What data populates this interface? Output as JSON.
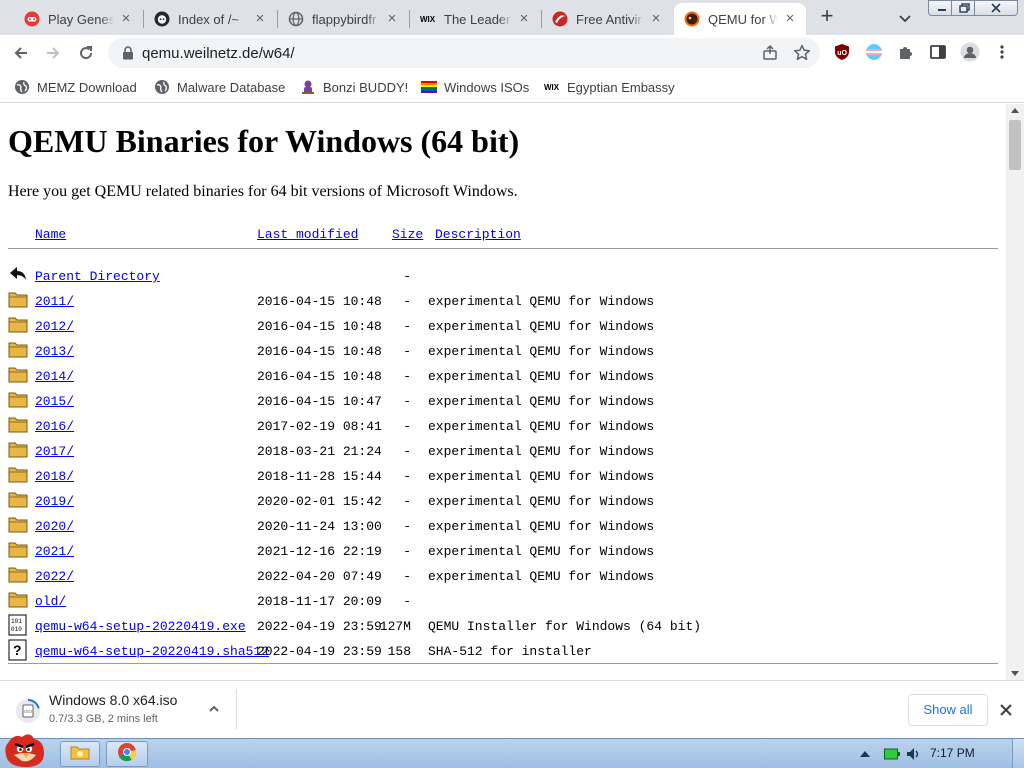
{
  "browser": {
    "tabs": [
      {
        "title": "Play Genesis",
        "favicon": "red-game-icon"
      },
      {
        "title": "Index of /~",
        "favicon": "github-cat-icon"
      },
      {
        "title": "flappybirdfr",
        "favicon": "globe-icon"
      },
      {
        "title": "The Leader",
        "favicon": "wix-icon"
      },
      {
        "title": "Free Antivir",
        "favicon": "red-shield-icon"
      },
      {
        "title": "QEMU for W",
        "favicon": "qemu-icon",
        "active": true
      }
    ],
    "new_tab": "+",
    "url": "qemu.weilnetz.de/w64/",
    "bookmarks": [
      {
        "label": "MEMZ Download",
        "icon": "globe-icon"
      },
      {
        "label": "Malware Database",
        "icon": "globe-icon"
      },
      {
        "label": "Bonzi BUDDY!",
        "icon": "bonzi-icon"
      },
      {
        "label": "Windows ISOs",
        "icon": "rainbow-flag-icon"
      },
      {
        "label": "Egyptian Embassy",
        "icon": "wix-icon"
      }
    ]
  },
  "page": {
    "title": "QEMU Binaries for Windows (64 bit)",
    "intro": "Here you get QEMU related binaries for 64 bit versions of Microsoft Windows.",
    "headers": {
      "name": "Name",
      "modified": "Last modified",
      "size": "Size",
      "description": "Description"
    },
    "rows": [
      {
        "icon": "back",
        "name": "Parent Directory",
        "date": "",
        "size": "-",
        "desc": ""
      },
      {
        "icon": "folder",
        "name": "2011/",
        "date": "2016-04-15 10:48",
        "size": "-",
        "desc": "experimental QEMU for Windows"
      },
      {
        "icon": "folder",
        "name": "2012/",
        "date": "2016-04-15 10:48",
        "size": "-",
        "desc": "experimental QEMU for Windows"
      },
      {
        "icon": "folder",
        "name": "2013/",
        "date": "2016-04-15 10:48",
        "size": "-",
        "desc": "experimental QEMU for Windows"
      },
      {
        "icon": "folder",
        "name": "2014/",
        "date": "2016-04-15 10:48",
        "size": "-",
        "desc": "experimental QEMU for Windows"
      },
      {
        "icon": "folder",
        "name": "2015/",
        "date": "2016-04-15 10:47",
        "size": "-",
        "desc": "experimental QEMU for Windows"
      },
      {
        "icon": "folder",
        "name": "2016/",
        "date": "2017-02-19 08:41",
        "size": "-",
        "desc": "experimental QEMU for Windows"
      },
      {
        "icon": "folder",
        "name": "2017/",
        "date": "2018-03-21 21:24",
        "size": "-",
        "desc": "experimental QEMU for Windows"
      },
      {
        "icon": "folder",
        "name": "2018/",
        "date": "2018-11-28 15:44",
        "size": "-",
        "desc": "experimental QEMU for Windows"
      },
      {
        "icon": "folder",
        "name": "2019/",
        "date": "2020-02-01 15:42",
        "size": "-",
        "desc": "experimental QEMU for Windows"
      },
      {
        "icon": "folder",
        "name": "2020/",
        "date": "2020-11-24 13:00",
        "size": "-",
        "desc": "experimental QEMU for Windows"
      },
      {
        "icon": "folder",
        "name": "2021/",
        "date": "2021-12-16 22:19",
        "size": "-",
        "desc": "experimental QEMU for Windows"
      },
      {
        "icon": "folder",
        "name": "2022/",
        "date": "2022-04-20 07:49",
        "size": "-",
        "desc": "experimental QEMU for Windows"
      },
      {
        "icon": "folder",
        "name": "old/",
        "date": "2018-11-17 20:09",
        "size": "-",
        "desc": ""
      },
      {
        "icon": "binary",
        "name": "qemu-w64-setup-20220419.exe",
        "date": "2022-04-19 23:59",
        "size": "127M",
        "desc": "QEMU Installer for Windows (64 bit)"
      },
      {
        "icon": "unknown",
        "name": "qemu-w64-setup-20220419.sha512",
        "date": "2022-04-19 23:59",
        "size": "158",
        "desc": "SHA-512 for installer"
      }
    ]
  },
  "download": {
    "filename": "Windows 8.0 x64.iso",
    "status": "0.7/3.3 GB, 2 mins left",
    "progress_fraction": 0.21,
    "show_all": "Show all"
  },
  "taskbar": {
    "clock": "7:17 PM",
    "pinned": [
      "explorer-icon",
      "chrome-icon"
    ]
  },
  "colors": {
    "link": "#0000ee",
    "accent": "#1a73e8",
    "tabstrip": "#dee1e6",
    "folder": "#e8b547"
  }
}
